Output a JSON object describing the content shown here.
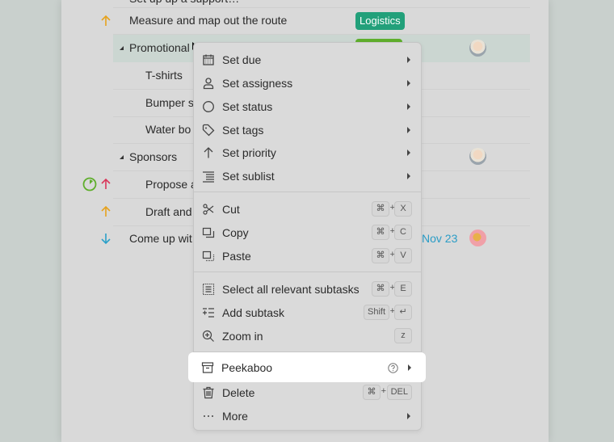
{
  "tasks": [
    {
      "title": "Set up up a support…",
      "partial": true
    },
    {
      "title": "Measure and map out the route",
      "priority": "medium",
      "tag": "Logistics",
      "tag_color": "#22a07a"
    },
    {
      "title": "Promotional",
      "collapsible": true,
      "selected": true,
      "tag_color": "#5fae2c",
      "avatar": "woman-gray-hair"
    },
    {
      "title": "T-shirts",
      "indent": 1
    },
    {
      "title": "Bumper s",
      "indent": 1
    },
    {
      "title": "Water bo",
      "indent": 1
    },
    {
      "title": "Sponsors",
      "collapsible": true,
      "avatar": "woman-gray-hair"
    },
    {
      "title": "Propose a",
      "indent": 1,
      "priority": "high",
      "status": "in-progress"
    },
    {
      "title": "Draft and",
      "indent": 1,
      "priority": "medium"
    },
    {
      "title": "Come up wit",
      "priority": "low",
      "due": "Nov 23",
      "avatar": "man-sunglasses-pink"
    }
  ],
  "colors": {
    "priority_high": "#d9365a",
    "priority_medium": "#e6a21c",
    "priority_low": "#2aa0c8",
    "status_in_progress": "#5fae2c",
    "due_date": "#2a9cc6"
  },
  "context_menu": {
    "groups": [
      [
        {
          "label": "Set due",
          "icon": "calendar-icon",
          "submenu": true
        },
        {
          "label": "Set assigness",
          "icon": "person-icon",
          "submenu": true
        },
        {
          "label": "Set status",
          "icon": "circle-icon",
          "submenu": true
        },
        {
          "label": "Set tags",
          "icon": "tag-icon",
          "submenu": true
        },
        {
          "label": "Set priority",
          "icon": "arrow-up-icon",
          "submenu": true
        },
        {
          "label": "Set sublist",
          "icon": "sublist-icon",
          "submenu": true
        }
      ],
      [
        {
          "label": "Cut",
          "icon": "scissors-icon",
          "shortcut": [
            "⌘",
            "X"
          ]
        },
        {
          "label": "Copy",
          "icon": "copy-icon",
          "shortcut": [
            "⌘",
            "C"
          ]
        },
        {
          "label": "Paste",
          "icon": "paste-icon",
          "shortcut": [
            "⌘",
            "V"
          ]
        }
      ],
      [
        {
          "label": "Select all relevant subtasks",
          "icon": "select-all-icon",
          "shortcut": [
            "⌘",
            "E"
          ]
        },
        {
          "label": "Add subtask",
          "icon": "add-subtask-icon",
          "shortcut": [
            "Shift",
            "↵"
          ]
        },
        {
          "label": "Zoom in",
          "icon": "zoom-in-icon",
          "shortcut": [
            "z"
          ]
        }
      ],
      [
        {
          "label": "Peekaboo",
          "icon": "archive-icon",
          "help": true,
          "submenu": true,
          "highlighted": true
        },
        {
          "label": "Delete",
          "icon": "trash-icon",
          "shortcut": [
            "⌘",
            "DEL"
          ]
        },
        {
          "label": "More",
          "icon": "ellipsis-icon",
          "submenu": true
        }
      ]
    ],
    "plus": "+"
  }
}
